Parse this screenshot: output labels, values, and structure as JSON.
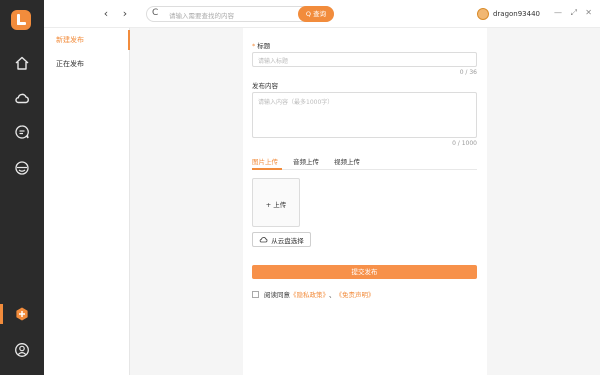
{
  "topbar": {
    "back_icon": "chevron-left-icon",
    "forward_icon": "chevron-right-icon",
    "refresh_label": "C",
    "search_placeholder": "请输入需要查找的内容",
    "search_button": "Q 查询",
    "username": "dragon93440",
    "window_controls": [
      "—",
      "⤢",
      "✕"
    ]
  },
  "rail": {
    "icons": [
      "logo-icon",
      "home-icon",
      "cloud-icon",
      "chat-icon",
      "disk-icon",
      "add-icon",
      "user-icon"
    ],
    "accent": "#f28c3c"
  },
  "menu": {
    "items": [
      {
        "label": "新建发布",
        "active": true
      },
      {
        "label": "正在发布",
        "active": false
      }
    ]
  },
  "form": {
    "title_label": "标题",
    "required_mark": "*",
    "title_placeholder": "请输入标题",
    "title_count": "0 / 36",
    "content_label": "发布内容",
    "content_placeholder": "请输入内容（最多1000字）",
    "content_count": "0 / 1000",
    "tabs": [
      "图片上传",
      "音频上传",
      "视频上传"
    ],
    "upload_label": "+ 上传",
    "cloud_select_label": "从云盘选择",
    "submit_label": "提交发布",
    "agree_prefix": "阅读同意",
    "privacy_link": "《隐私政策》",
    "separator": "、",
    "disclaimer_link": "《免责声明》"
  },
  "colors": {
    "accent": "#f28c3c",
    "rail_bg": "#2b2b2b"
  }
}
